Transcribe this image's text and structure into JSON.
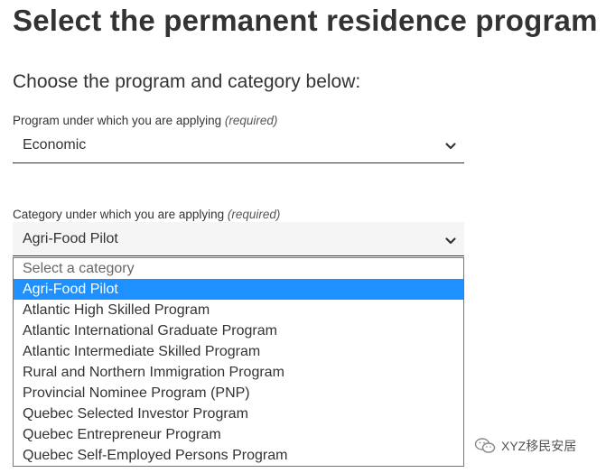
{
  "page": {
    "title": "Select the permanent residence program",
    "subtitle": "Choose the program and category below:"
  },
  "program_field": {
    "label": "Program under which you are applying",
    "required_note": "(required)",
    "selected_value": "Economic"
  },
  "category_field": {
    "label": "Category under which you are applying",
    "required_note": "(required)",
    "selected_value": "Agri-Food Pilot",
    "options": [
      {
        "label": "Select a category",
        "state": "placeholder"
      },
      {
        "label": "Agri-Food Pilot",
        "state": "selected"
      },
      {
        "label": "Atlantic High Skilled Program",
        "state": "normal"
      },
      {
        "label": "Atlantic International Graduate Program",
        "state": "normal"
      },
      {
        "label": "Atlantic Intermediate Skilled Program",
        "state": "normal"
      },
      {
        "label": "Rural and Northern Immigration Program",
        "state": "normal"
      },
      {
        "label": "Provincial Nominee Program (PNP)",
        "state": "normal"
      },
      {
        "label": "Quebec Selected Investor Program",
        "state": "normal"
      },
      {
        "label": "Quebec Entrepreneur Program",
        "state": "normal"
      },
      {
        "label": "Quebec Self-Employed Persons Program",
        "state": "normal"
      }
    ]
  },
  "watermark": {
    "text": "XYZ移民安居",
    "icon": "wechat-icon"
  },
  "colors": {
    "text": "#333333",
    "highlight": "#1e90ff",
    "select_background": "#f5f5f5"
  }
}
